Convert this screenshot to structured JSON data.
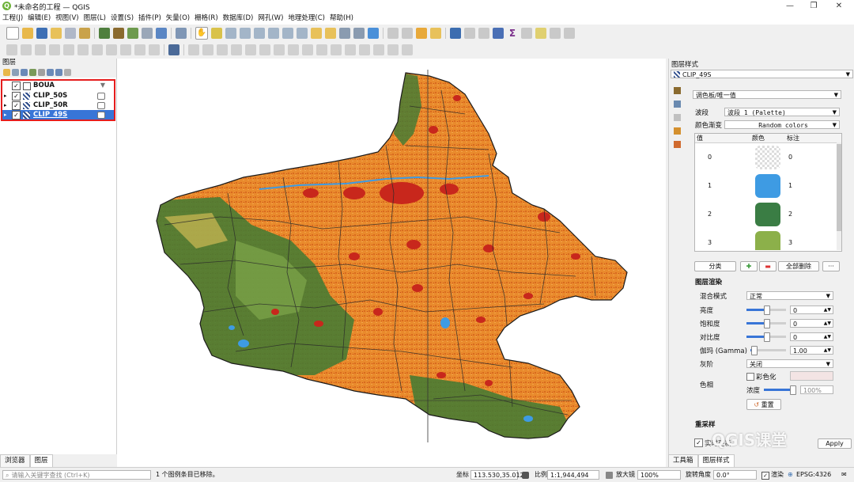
{
  "window": {
    "title": "*未命名的工程 — QGIS"
  },
  "menu": [
    "工程(J)",
    "编辑(E)",
    "视图(V)",
    "图层(L)",
    "设置(S)",
    "插件(P)",
    "矢量(O)",
    "栅格(R)",
    "数据库(D)",
    "网孔(W)",
    "地理处理(C)",
    "帮助(H)"
  ],
  "layers_panel": {
    "title": "图层",
    "layers": [
      {
        "name": "BOUA",
        "checked": true,
        "selected": false
      },
      {
        "name": "CLIP_50S",
        "checked": true,
        "selected": false
      },
      {
        "name": "CLIP_50R",
        "checked": true,
        "selected": false
      },
      {
        "name": "CLIP_49S",
        "checked": true,
        "selected": true
      }
    ],
    "tabs": [
      "浏览器",
      "图层"
    ]
  },
  "style_panel": {
    "title": "图层样式",
    "layer_select": "CLIP_49S",
    "renderer": "调色板/唯一值",
    "band_label": "波段",
    "band_value": "波段 1 (Palette)",
    "ramp_label": "颜色渐变",
    "ramp_value": "Random colors",
    "table_headers": [
      "值",
      "颜色",
      "标注"
    ],
    "table_rows": [
      {
        "value": "0",
        "label": "0",
        "color": "transparent"
      },
      {
        "value": "1",
        "label": "1",
        "color": "#3e9be3"
      },
      {
        "value": "2",
        "label": "2",
        "color": "#3a7d44"
      },
      {
        "value": "3",
        "label": "3",
        "color": "#8cb04a"
      }
    ],
    "classify_button": "分类",
    "delete_all_button": "全部删除",
    "more_button": "···",
    "rendering_title": "图层渲染",
    "blend_label": "混合模式",
    "blend_value": "正常",
    "brightness_label": "亮度",
    "brightness_value": "0",
    "saturation_label": "饱和度",
    "saturation_value": "0",
    "contrast_label": "对比度",
    "contrast_value": "0",
    "gamma_label": "伽玛 (Gamma)",
    "gamma_value": "1.00",
    "grayscale_label": "灰阶",
    "grayscale_value": "关闭",
    "hue_label": "色相",
    "colorize_label": "彩色化",
    "strength_label": "浓度",
    "strength_value": "100%",
    "reset_button": "重置",
    "resample_label": "重采样",
    "live_update_label": "实时更新",
    "apply_button": "Apply",
    "tabs": [
      "工具箱",
      "图层样式"
    ]
  },
  "status": {
    "search_placeholder": "请输入关键字查找 (Ctrl+K)",
    "message": "1 个图例条目已移除。",
    "coord_label": "坐标",
    "coord_value": "113.530,35.012",
    "scale_label": "比例",
    "scale_value": "1:1,944,494",
    "magnifier_label": "放大镜",
    "magnifier_value": "100%",
    "rotation_label": "旋转角度",
    "rotation_value": "0.0°",
    "render_label": "渲染",
    "crs": "EPSG:4326"
  },
  "watermark": "QGIS课堂"
}
